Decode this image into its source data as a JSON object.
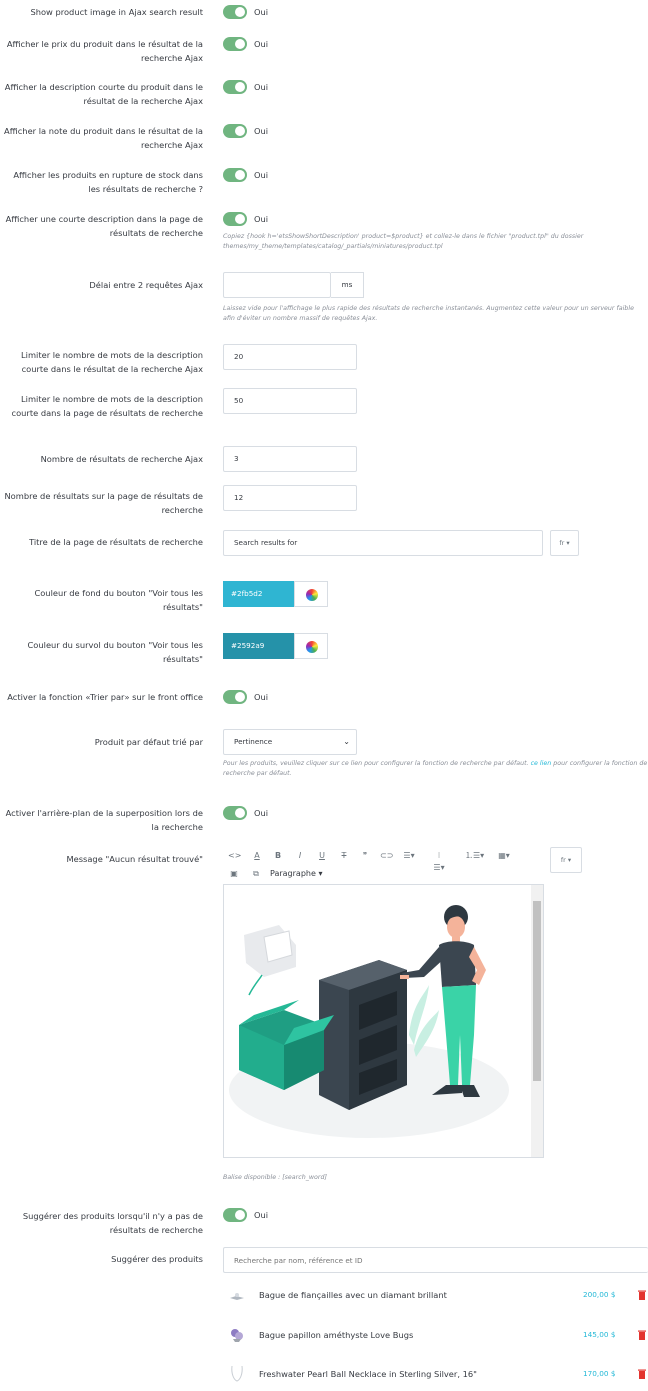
{
  "settings": {
    "show_image": {
      "label": "Show product image in Ajax search result",
      "value": "Oui"
    },
    "show_price": {
      "label": "Afficher le prix du produit dans le résultat de la recherche Ajax",
      "value": "Oui"
    },
    "show_short_desc": {
      "label": "Afficher la description courte du produit dans le résultat de la recherche Ajax",
      "value": "Oui"
    },
    "show_rating": {
      "label": "Afficher la note du produit dans le résultat de la recherche Ajax",
      "value": "Oui"
    },
    "show_out_of_stock": {
      "label": "Afficher les produits en rupture de stock dans les résultats de recherche ?",
      "value": "Oui"
    },
    "show_desc_results_page": {
      "label": "Afficher une courte description dans la page de résultats de recherche",
      "value": "Oui",
      "help": "Copiez {hook h='etsShowShortDescription' product=$product} et collez-le dans le fichier \"product.tpl\" du dossier themes/my_theme/templates/catalog/_partials/miniatures/product.tpl"
    },
    "ajax_delay": {
      "label": "Délai entre 2 requêtes Ajax",
      "value": "",
      "unit": "ms",
      "help": "Laissez vide pour l'affichage le plus rapide des résultats de recherche instantanés. Augmentez cette valeur pour un serveur faible afin d'éviter un nombre massif de requêtes Ajax."
    },
    "limit_words_ajax": {
      "label": "Limiter le nombre de mots de la description courte dans le résultat de la recherche Ajax",
      "value": "20"
    },
    "limit_words_page": {
      "label": "Limiter le nombre de mots de la description courte dans la page de résultats de recherche",
      "value": "50"
    },
    "num_results_ajax": {
      "label": "Nombre de résultats de recherche Ajax",
      "value": "3"
    },
    "num_results_page": {
      "label": "Nombre de résultats sur la page de résultats de recherche",
      "value": "12"
    },
    "page_title": {
      "label": "Titre de la page de résultats de recherche",
      "value": "Search results for",
      "lang": "fr"
    },
    "bg_color": {
      "label": "Couleur de fond du bouton \"Voir tous les résultats\"",
      "value": "#2fb5d2"
    },
    "hover_color": {
      "label": "Couleur du survol du bouton \"Voir tous les résultats\"",
      "value": "#2592a9"
    },
    "sort_by": {
      "label": "Activer la fonction «Trier par» sur le front office",
      "value": "Oui"
    },
    "default_sort": {
      "label": "Produit par défaut trié par",
      "value": "Pertinence",
      "help_before": "Pour les produits, veuillez cliquer sur ce lien pour configurer la fonction de recherche par défaut.",
      "help_link": "ce lien",
      "help_after": "pour configurer la fonction de recherche par défaut."
    },
    "overlay_bg": {
      "label": "Activer l'arrière-plan de la superposition lors de la recherche",
      "value": "Oui"
    },
    "no_result_msg": {
      "label": "Message \"Aucun résultat trouvé\"",
      "lang": "fr",
      "paragraph": "Paragraphe",
      "help": "Balise disponible : [search_word]"
    },
    "suggest_products": {
      "label": "Suggérer des produits lorsqu'il n'y a pas de résultats de recherche",
      "value": "Oui"
    },
    "suggested": {
      "label": "Suggérer des produits",
      "placeholder": "Recherche par nom, référence et ID",
      "items": [
        {
          "name": "Bague de fiançailles avec un diamant brillant",
          "price": "200,00 $"
        },
        {
          "name": "Bague papillon améthyste Love Bugs",
          "price": "145,00 $"
        },
        {
          "name": "Freshwater Pearl Ball Necklace in Sterling Silver, 16\"",
          "price": "170,00 $"
        }
      ]
    }
  },
  "colors": {
    "toggle_on": "#70b580",
    "accent": "#25b9d7",
    "delete": "#e3342f"
  }
}
